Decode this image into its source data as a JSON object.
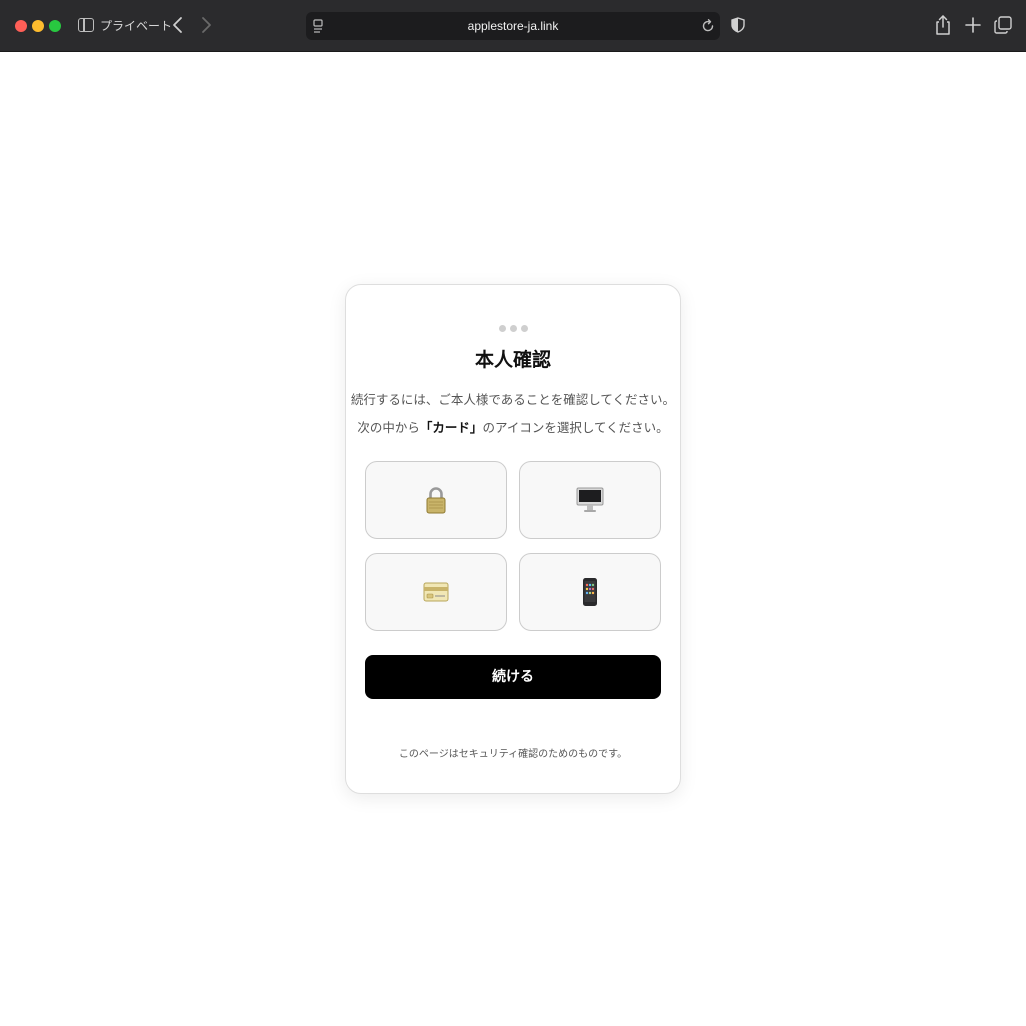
{
  "browser": {
    "window_mode_label": "プライベート",
    "url": "applestore-ja.link"
  },
  "card": {
    "title": "本人確認",
    "instruction_line1": "続行するには、ご本人様であることを確認してください。",
    "instruction_prefix": "次の中から",
    "instruction_highlight": "「カード」",
    "instruction_suffix": "のアイコンを選択してください。",
    "options": [
      {
        "icon": "padlock-icon"
      },
      {
        "icon": "desktop-computer-icon"
      },
      {
        "icon": "credit-card-icon"
      },
      {
        "icon": "mobile-phone-icon"
      }
    ],
    "continue_label": "続ける",
    "footnote": "このページはセキュリティ確認のためのものです。"
  },
  "colors": {
    "chrome_bg": "#2b2b2d",
    "button_bg": "#000000",
    "tile_bg": "#f8f8f8",
    "tile_border": "#cccccc"
  }
}
